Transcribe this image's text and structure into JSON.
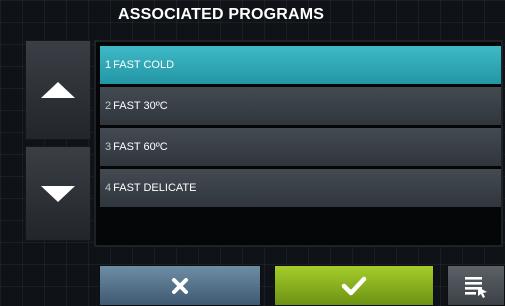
{
  "header": {
    "title": "ASSOCIATED PROGRAMS"
  },
  "programs": [
    {
      "number": "1",
      "name": "FAST COLD",
      "selected": true
    },
    {
      "number": "2",
      "name": "FAST 30ºC",
      "selected": false
    },
    {
      "number": "3",
      "name": "FAST 60ºC",
      "selected": false
    },
    {
      "number": "4",
      "name": "FAST DELICATE",
      "selected": false
    }
  ],
  "icons": {
    "scroll_up": "triangle-up-icon",
    "scroll_down": "triangle-down-icon",
    "cancel": "x-icon",
    "confirm": "checkmark-icon",
    "menu": "list-cursor-icon"
  },
  "colors": {
    "selected_item": "#2fa9b8",
    "confirm_button": "#8ab51f",
    "cancel_button": "#56738b"
  }
}
